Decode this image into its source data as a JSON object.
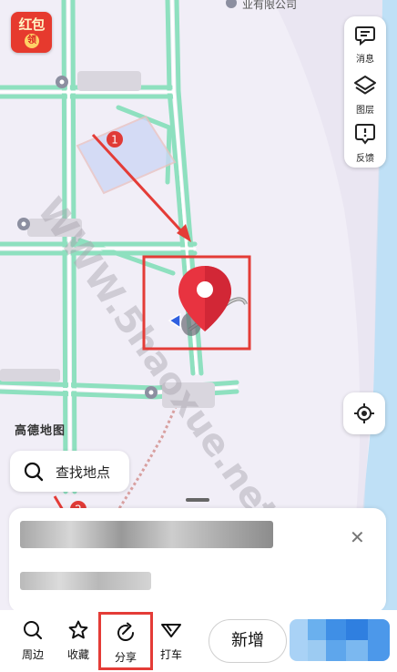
{
  "map": {
    "top_label": "业有限公司",
    "logo": "高德地图",
    "marker_step_1": "1",
    "marker_step_2": "2"
  },
  "hongbao": {
    "label": "红包",
    "coin": "领"
  },
  "right_toolbar": {
    "items": [
      {
        "label": "消息",
        "icon": "message-icon"
      },
      {
        "label": "图层",
        "icon": "layers-icon"
      },
      {
        "label": "反馈",
        "icon": "feedback-icon"
      }
    ]
  },
  "search": {
    "placeholder": "查找地点"
  },
  "bottom_bar": {
    "items": [
      {
        "label": "周边",
        "icon": "search-nearby-icon"
      },
      {
        "label": "收藏",
        "icon": "star-icon"
      },
      {
        "label": "分享",
        "icon": "share-icon"
      },
      {
        "label": "打车",
        "icon": "taxi-icon"
      }
    ],
    "new_button": "新增"
  },
  "colors": {
    "pin": "#e83340",
    "annotation_red": "#e43c37",
    "road": "#8fe0c0",
    "river": "#b9dcf5"
  },
  "watermark": "WWW.5haoxue.net 资源网"
}
